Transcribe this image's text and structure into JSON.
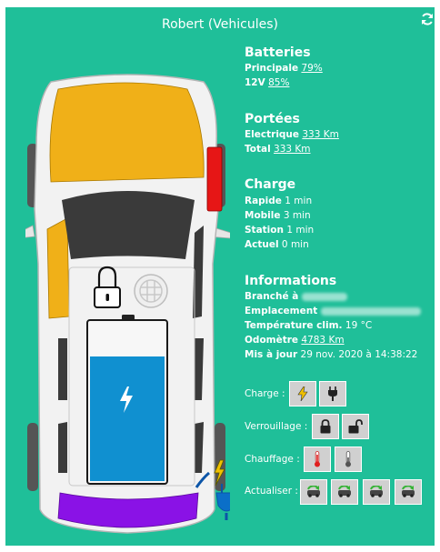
{
  "header": {
    "title": "Robert (Vehicules)"
  },
  "icons": {
    "refresh": "refresh-icon",
    "lock": "lock-icon",
    "logo": "vehicle-logo-icon",
    "charge": "lightning-icon",
    "plug": "plug-icon"
  },
  "batteries": {
    "title": "Batteries",
    "principale_label": "Principale",
    "principale_value": "79%",
    "v12_label": "12V",
    "v12_value": "85%",
    "fill_level": 0.79
  },
  "portees": {
    "title": "Portées",
    "electrique_label": "Electrique",
    "electrique_value": "333 Km",
    "total_label": "Total",
    "total_value": "333 Km"
  },
  "charge": {
    "title": "Charge",
    "rapide_label": "Rapide",
    "rapide_value": "1 min",
    "mobile_label": "Mobile",
    "mobile_value": "3 min",
    "station_label": "Station",
    "station_value": "1 min",
    "actuel_label": "Actuel",
    "actuel_value": "0 min"
  },
  "informations": {
    "title": "Informations",
    "branche_label": "Branché à",
    "emplacement_label": "Emplacement",
    "temperature_label": "Température clim.",
    "temperature_value": "19 °C",
    "odometre_label": "Odomètre",
    "odometre_value": "4783 Km",
    "maj_label": "Mis à jour",
    "maj_value": "29 nov. 2020 à 14:38:22"
  },
  "controls": {
    "charge_label": "Charge :",
    "verrouillage_label": "Verrouillage :",
    "chauffage_label": "Chauffage :",
    "actualiser_label": "Actualiser :"
  },
  "colors": {
    "background": "#1fbf99",
    "door": "#f0b018",
    "trunk": "#8a12e6",
    "battery": "#1090d0",
    "taillight": "#e61616",
    "button": "#d0d0d0"
  }
}
